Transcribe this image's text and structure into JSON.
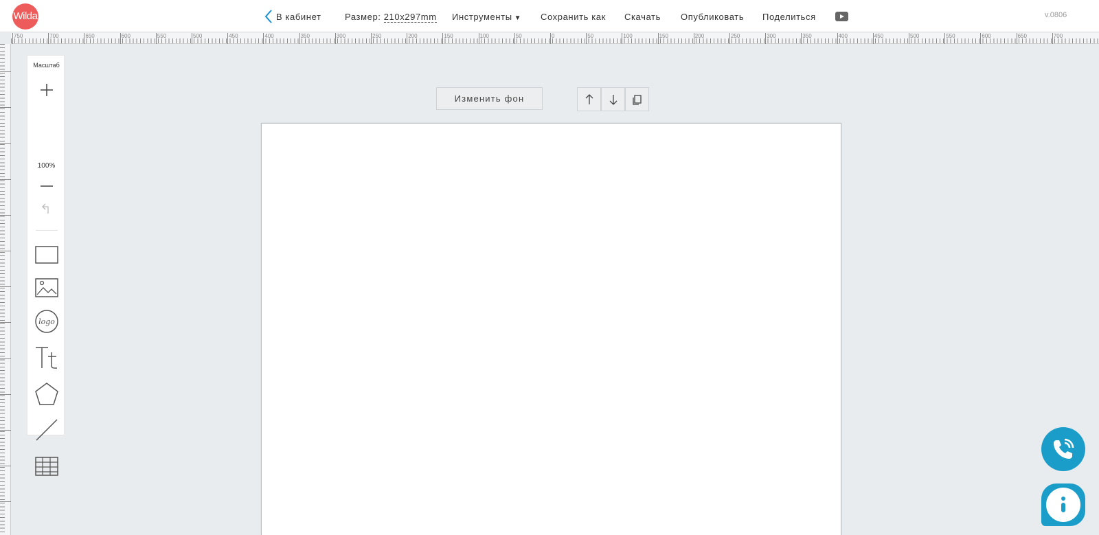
{
  "header": {
    "logo_text": "Wilda",
    "back_label": "В кабинет",
    "size_label": "Размер:",
    "size_value": "210x297mm",
    "tools_label": "Инструменты",
    "tools_caret": "▼",
    "save_as_label": "Сохранить как",
    "download_label": "Скачать",
    "publish_label": "Опубликовать",
    "share_label": "Поделиться",
    "version": "v.0806"
  },
  "ruler": {
    "top_labels": [
      "750",
      "700",
      "650",
      "600",
      "550",
      "500",
      "450",
      "400",
      "350",
      "300",
      "250",
      "200",
      "150",
      "100",
      "50",
      "0",
      "50",
      "100",
      "150",
      "200",
      "250",
      "300",
      "350",
      "400",
      "450",
      "500",
      "550",
      "600",
      "650",
      "700"
    ]
  },
  "toolbar": {
    "title": "Масштаб",
    "zoom": "100%",
    "tools": [
      "zoom-in",
      "zoom-out",
      "undo",
      "rectangle",
      "image",
      "logo",
      "text",
      "polygon",
      "line",
      "table"
    ]
  },
  "canvas": {
    "change_bg_label": "Изменить фон"
  },
  "colors": {
    "brand": "#ee5b5b",
    "accent": "#1b9dc9",
    "back_arrow": "#1b8fd6"
  }
}
